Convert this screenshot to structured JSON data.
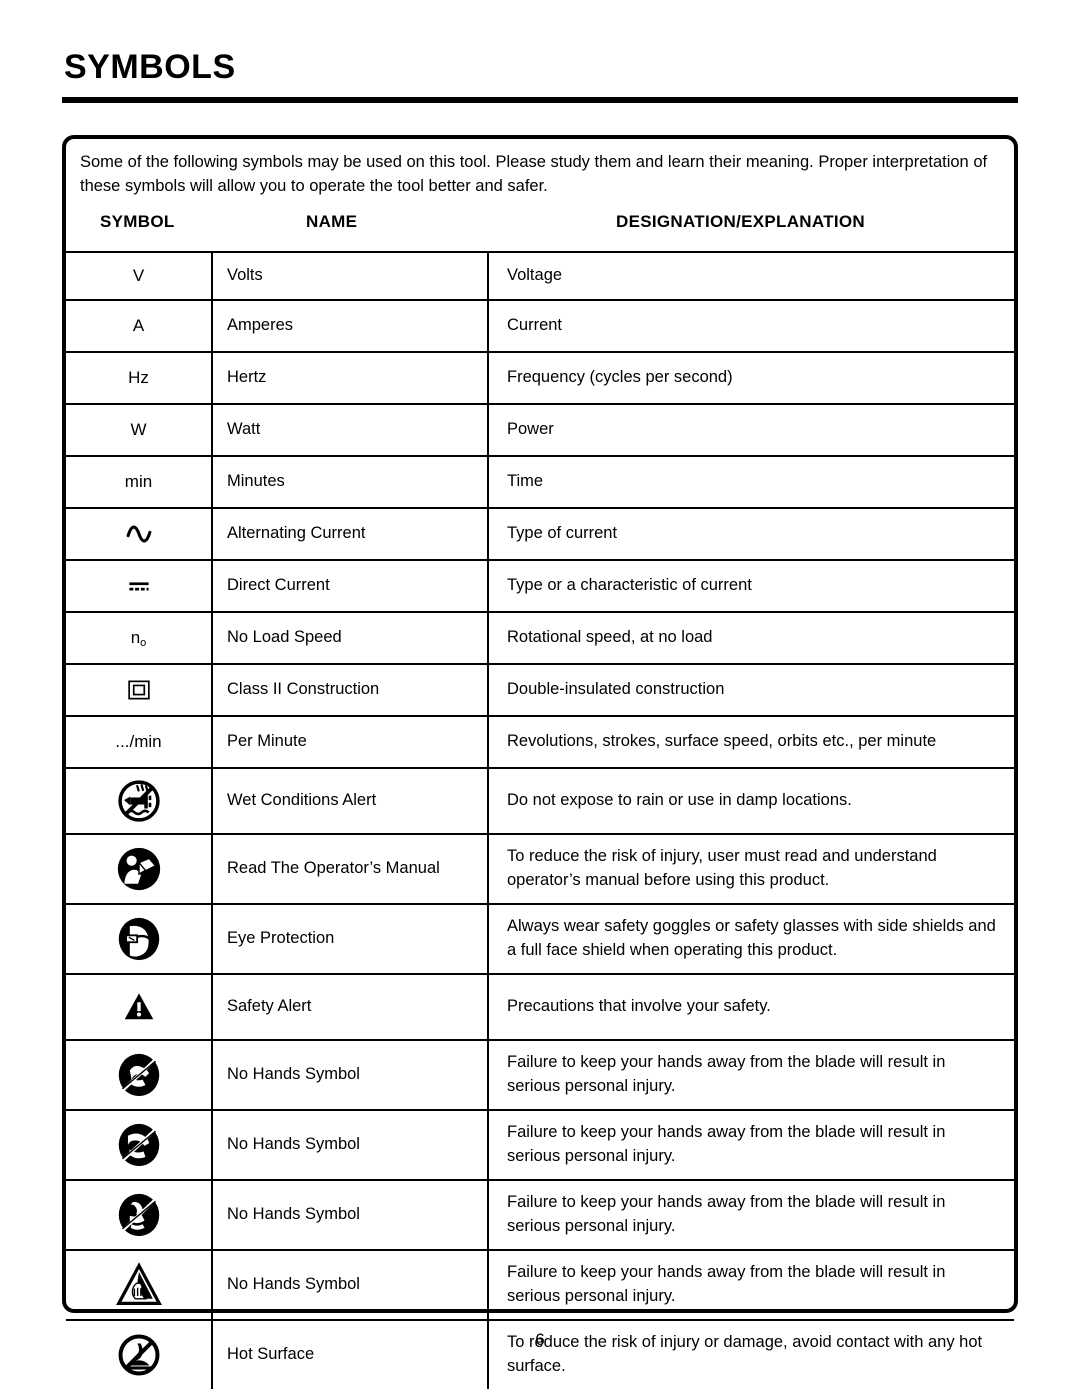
{
  "document": {
    "title": "SYMBOLS",
    "page_number": "6",
    "intro": "Some of the following symbols may be used on this tool. Please study them and learn their meaning. Proper interpretation of these symbols will allow you to operate the tool better and safer."
  },
  "table": {
    "headers": {
      "symbol": "SYMBOL",
      "name": "NAME",
      "designation": "DESIGNATION/EXPLANATION"
    },
    "rows": [
      {
        "symbol_text": "V",
        "symbol_kind": "text",
        "icon_name": "volts-symbol",
        "name": "Volts",
        "designation": "Voltage",
        "height": "row-h1"
      },
      {
        "symbol_text": "A",
        "symbol_kind": "text",
        "icon_name": "amperes-symbol",
        "name": "Amperes",
        "designation": "Current",
        "height": "row-h2"
      },
      {
        "symbol_text": "Hz",
        "symbol_kind": "text",
        "icon_name": "hertz-symbol",
        "name": "Hertz",
        "designation": "Frequency (cycles per second)",
        "height": "row-h2"
      },
      {
        "symbol_text": "W",
        "symbol_kind": "text",
        "icon_name": "watt-symbol",
        "name": "Watt",
        "designation": "Power",
        "height": "row-h2"
      },
      {
        "symbol_text": "min",
        "symbol_kind": "text",
        "icon_name": "minutes-symbol",
        "name": "Minutes",
        "designation": "Time",
        "height": "row-h2"
      },
      {
        "symbol_text": "",
        "symbol_kind": "alternating-current",
        "icon_name": "alternating-current-icon",
        "name": "Alternating Current",
        "designation": "Type of current",
        "height": "row-h2"
      },
      {
        "symbol_text": "",
        "symbol_kind": "direct-current",
        "icon_name": "direct-current-icon",
        "name": "Direct Current",
        "designation": "Type or a characteristic of current",
        "height": "row-h2"
      },
      {
        "symbol_text": "n",
        "symbol_sub": "o",
        "symbol_kind": "subscript",
        "icon_name": "no-load-speed-symbol",
        "name": "No Load Speed",
        "designation": "Rotational speed, at no load",
        "height": "row-h2"
      },
      {
        "symbol_text": "",
        "symbol_kind": "class-two",
        "icon_name": "class-ii-construction-icon",
        "name": "Class II Construction",
        "designation": "Double-insulated construction",
        "height": "row-h2"
      },
      {
        "symbol_text": ".../min",
        "symbol_kind": "text",
        "icon_name": "per-minute-symbol",
        "name": "Per Minute",
        "designation": "Revolutions, strokes, surface speed, orbits etc., per minute",
        "height": "row-h2"
      },
      {
        "symbol_text": "",
        "symbol_kind": "wet-conditions",
        "icon_name": "wet-conditions-alert-icon",
        "name": "Wet Conditions Alert",
        "designation": "Do not expose to rain or use in damp locations.",
        "height": "row-h3"
      },
      {
        "symbol_text": "",
        "symbol_kind": "read-manual",
        "icon_name": "read-operators-manual-icon",
        "name": "Read The Operator’s Manual",
        "designation": "To reduce the risk of injury, user must read and understand operator’s manual before using this product.",
        "height": "row-h4"
      },
      {
        "symbol_text": "",
        "symbol_kind": "eye-protection",
        "icon_name": "eye-protection-icon",
        "name": "Eye Protection",
        "designation": "Always wear safety goggles or safety glasses with side shields and a full face shield when operating this product.",
        "height": "row-h4"
      },
      {
        "symbol_text": "",
        "symbol_kind": "safety-alert",
        "icon_name": "safety-alert-icon",
        "name": "Safety Alert",
        "designation": "Precautions that involve your safety.",
        "height": "row-h3"
      },
      {
        "symbol_text": "",
        "symbol_kind": "no-hands-a",
        "icon_name": "no-hands-symbol-icon",
        "name": "No Hands Symbol",
        "designation": "Failure to keep your hands away from the blade will result in serious personal injury.",
        "height": "row-h4"
      },
      {
        "symbol_text": "",
        "symbol_kind": "no-hands-b",
        "icon_name": "no-hands-symbol-icon",
        "name": "No Hands Symbol",
        "designation": "Failure to keep your hands away from the blade will result in serious personal injury.",
        "height": "row-h4"
      },
      {
        "symbol_text": "",
        "symbol_kind": "no-hands-c",
        "icon_name": "no-hands-symbol-icon",
        "name": "No Hands Symbol",
        "designation": "Failure to keep your hands away from the blade will result in serious personal injury.",
        "height": "row-h4"
      },
      {
        "symbol_text": "",
        "symbol_kind": "no-hands-triangle",
        "icon_name": "no-hands-triangle-icon",
        "name": "No Hands Symbol",
        "designation": "Failure to keep your hands away from the blade will result in serious personal injury.",
        "height": "row-h4"
      },
      {
        "symbol_text": "",
        "symbol_kind": "hot-surface",
        "icon_name": "hot-surface-icon",
        "name": "Hot Surface",
        "designation": "To reduce the risk of injury or damage, avoid contact with any hot surface.",
        "height": "row-h4"
      }
    ]
  },
  "colors": {
    "ink": "#000000",
    "paper": "#ffffff"
  }
}
